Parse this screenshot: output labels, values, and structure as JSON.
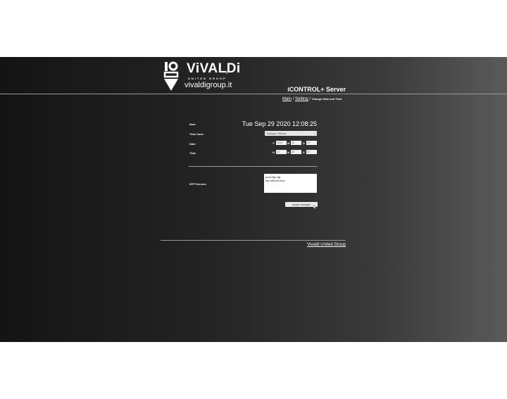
{
  "brand": {
    "name": "ViVALDi",
    "subtitle": "UNITED GROUP",
    "registered": "®",
    "site": "vivaldigroup.it"
  },
  "app_title": "iCONTROL+ Server",
  "breadcrumb": {
    "main": "Main",
    "sep1": "/",
    "setting": "Setting",
    "sep2": "/",
    "current": "Change Date and Time"
  },
  "form": {
    "now_label": "Now",
    "now_value": "Tue Sep 29 2020 12:08:25",
    "timezone_label": "Time Zone",
    "timezone_value": "Europe / Rome",
    "date_label": "Date",
    "date": {
      "y_label": "Y",
      "y_value": "2020",
      "m_label": "M",
      "m_value": "09",
      "d_label": "D",
      "d_value": "29"
    },
    "time_label": "Time",
    "time": {
      "h_label": "H",
      "h_value": "12",
      "m_label": "M",
      "m_value": "08",
      "s_label": "S",
      "s_value": "22"
    },
    "ntp_label": "NTP Servers",
    "ntp_lines": [
      "pool.ntp.org",
      "ntp.ubuntu.com"
    ],
    "apply_label": "Apply changes"
  },
  "footer": {
    "link": "Vivaldi United Group"
  },
  "icons": {
    "logo": "vivaldi-logo-icon",
    "dropdown": "chevron-updown-icon",
    "pointer": "mouse-cursor-icon"
  }
}
